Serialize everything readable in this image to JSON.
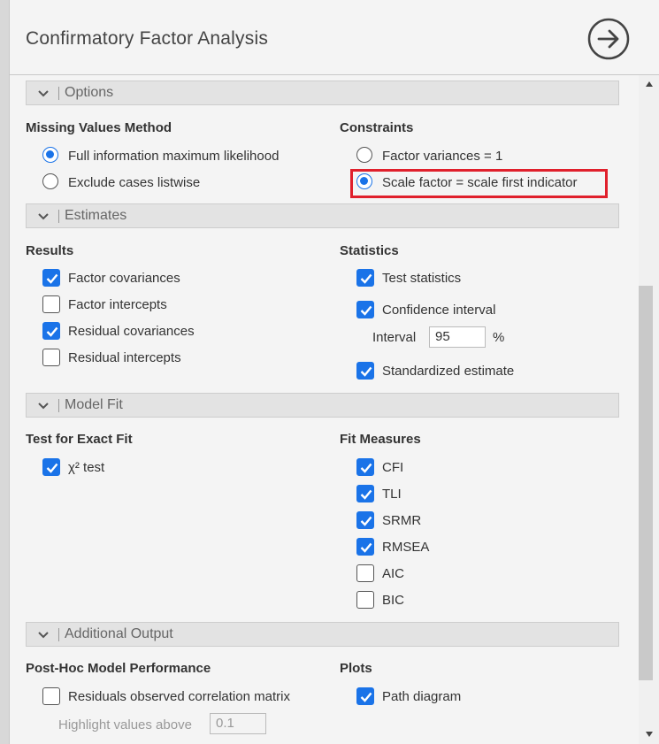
{
  "header": {
    "title": "Confirmatory Factor Analysis",
    "nav_icon": "arrow-right-circle-icon"
  },
  "options": {
    "label": "Options",
    "missing_values": {
      "label": "Missing Values Method",
      "items": [
        {
          "label": "Full information maximum likelihood",
          "selected": true
        },
        {
          "label": "Exclude cases listwise",
          "selected": false
        }
      ]
    },
    "constraints": {
      "label": "Constraints",
      "items": [
        {
          "label": "Factor variances = 1",
          "selected": false
        },
        {
          "label": "Scale factor = scale first indicator",
          "selected": true
        }
      ]
    }
  },
  "estimates": {
    "label": "Estimates",
    "results": {
      "label": "Results",
      "items": [
        {
          "label": "Factor covariances",
          "checked": true
        },
        {
          "label": "Factor intercepts",
          "checked": false
        },
        {
          "label": "Residual covariances",
          "checked": true
        },
        {
          "label": "Residual intercepts",
          "checked": false
        }
      ]
    },
    "statistics": {
      "label": "Statistics",
      "test_statistics": {
        "label": "Test statistics",
        "checked": true
      },
      "confidence_interval": {
        "label": "Confidence interval",
        "checked": true
      },
      "interval": {
        "label": "Interval",
        "value": "95",
        "unit": "%"
      },
      "standardized": {
        "label": "Standardized estimate",
        "checked": true
      }
    }
  },
  "model_fit": {
    "label": "Model Fit",
    "exact_fit": {
      "label": "Test for Exact Fit",
      "items": [
        {
          "label": "χ² test",
          "checked": true
        }
      ]
    },
    "fit_measures": {
      "label": "Fit Measures",
      "items": [
        {
          "label": "CFI",
          "checked": true
        },
        {
          "label": "TLI",
          "checked": true
        },
        {
          "label": "SRMR",
          "checked": true
        },
        {
          "label": "RMSEA",
          "checked": true
        },
        {
          "label": "AIC",
          "checked": false
        },
        {
          "label": "BIC",
          "checked": false
        }
      ]
    }
  },
  "additional_output": {
    "label": "Additional Output",
    "post_hoc": {
      "label": "Post-Hoc Model Performance",
      "residuals": {
        "label": "Residuals observed correlation matrix",
        "checked": false
      },
      "highlight": {
        "label": "Highlight values above",
        "value": "0.1"
      }
    },
    "plots": {
      "label": "Plots",
      "path_diagram": {
        "label": "Path diagram",
        "checked": true
      }
    }
  },
  "colors": {
    "accent": "#1a73e8",
    "highlight_box": "#e0202c",
    "section_bg": "#e3e3e3",
    "panel_bg": "#f4f4f4"
  }
}
